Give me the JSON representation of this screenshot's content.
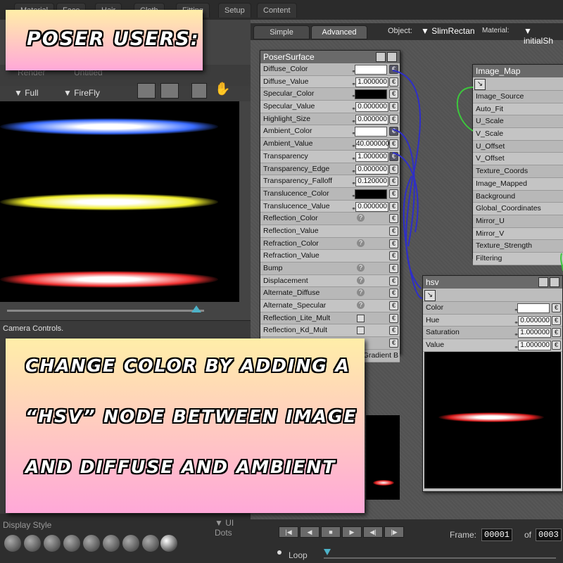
{
  "top_tabs": [
    "Material",
    "Face",
    "Hair",
    "Cloth",
    "Fitting",
    "Setup",
    "Content"
  ],
  "left": {
    "render_label": "Render",
    "untitled_label": "Untitled",
    "full_label": "Full",
    "firefly_label": "FireFly",
    "camera_controls": "Camera Controls.",
    "display_style": "Display Style",
    "ui_dots": "UI Dots",
    "streak_colors": [
      "#3a6cff",
      "#f2ef2a",
      "#f23030"
    ]
  },
  "shader_tabs": {
    "simple": "Simple",
    "advanced": "Advanced"
  },
  "object": {
    "label": "Object:",
    "value": "SlimRectan",
    "material_label": "Material:",
    "material_value": "initialSh"
  },
  "poser_surface": {
    "title": "PoserSurface",
    "rows": [
      {
        "label": "Diffuse_Color",
        "type": "white",
        "plug": "on"
      },
      {
        "label": "Diffuse_Value",
        "type": "val",
        "value": "1.000000"
      },
      {
        "label": "Specular_Color",
        "type": "black"
      },
      {
        "label": "Specular_Value",
        "type": "val",
        "value": "0.000000"
      },
      {
        "label": "Highlight_Size",
        "type": "val",
        "value": "0.000000"
      },
      {
        "label": "Ambient_Color",
        "type": "white",
        "plug": "on"
      },
      {
        "label": "Ambient_Value",
        "type": "val",
        "value": "40.000000"
      },
      {
        "label": "Transparency",
        "type": "val",
        "value": "1.000000",
        "plug": "on"
      },
      {
        "label": "Transparency_Edge",
        "type": "val",
        "value": "0.000000"
      },
      {
        "label": "Transparency_Falloff",
        "type": "val",
        "value": "0.120000"
      },
      {
        "label": "Translucence_Color",
        "type": "black"
      },
      {
        "label": "Translucence_Value",
        "type": "val",
        "value": "0.000000"
      },
      {
        "label": "Reflection_Color",
        "type": "q"
      },
      {
        "label": "Reflection_Value",
        "type": "none"
      },
      {
        "label": "Refraction_Color",
        "type": "q"
      },
      {
        "label": "Refraction_Value",
        "type": "none"
      },
      {
        "label": "Bump",
        "type": "q"
      },
      {
        "label": "Displacement",
        "type": "q"
      },
      {
        "label": "Alternate_Diffuse",
        "type": "q"
      },
      {
        "label": "Alternate_Specular",
        "type": "q"
      },
      {
        "label": "Reflection_Lite_Mult",
        "type": "cb"
      },
      {
        "label": "Reflection_Kd_Mult",
        "type": "cb"
      },
      {
        "label": "Gradient_Bump",
        "type": "q"
      }
    ],
    "gradient_label": "Gradient B"
  },
  "image_map": {
    "title": "Image_Map",
    "rows": [
      "Image_Source",
      "Auto_Fit",
      "U_Scale",
      "V_Scale",
      "U_Offset",
      "V_Offset",
      "Texture_Coords",
      "Image_Mapped",
      "Background",
      "Global_Coordinates",
      "Mirror_U",
      "Mirror_V",
      "Texture_Strength",
      "Filtering"
    ]
  },
  "hsv": {
    "title": "hsv",
    "rows": [
      {
        "label": "Color",
        "type": "white"
      },
      {
        "label": "Hue",
        "type": "val",
        "value": "0.000000"
      },
      {
        "label": "Saturation",
        "type": "val",
        "value": "1.000000"
      },
      {
        "label": "Value",
        "type": "val",
        "value": "1.000000"
      }
    ]
  },
  "playback": {
    "frame_label": "Frame:",
    "frame_value": "00001",
    "of_label": "of",
    "total_value": "0003",
    "loop_label": "Loop"
  },
  "banner_top": "POSER USERS:",
  "banner_main": [
    "CHANGE COLOR BY ADDING A",
    "“HSV” NODE BETWEEN IMAGE",
    "AND DIFFUSE AND AMBIENT"
  ]
}
